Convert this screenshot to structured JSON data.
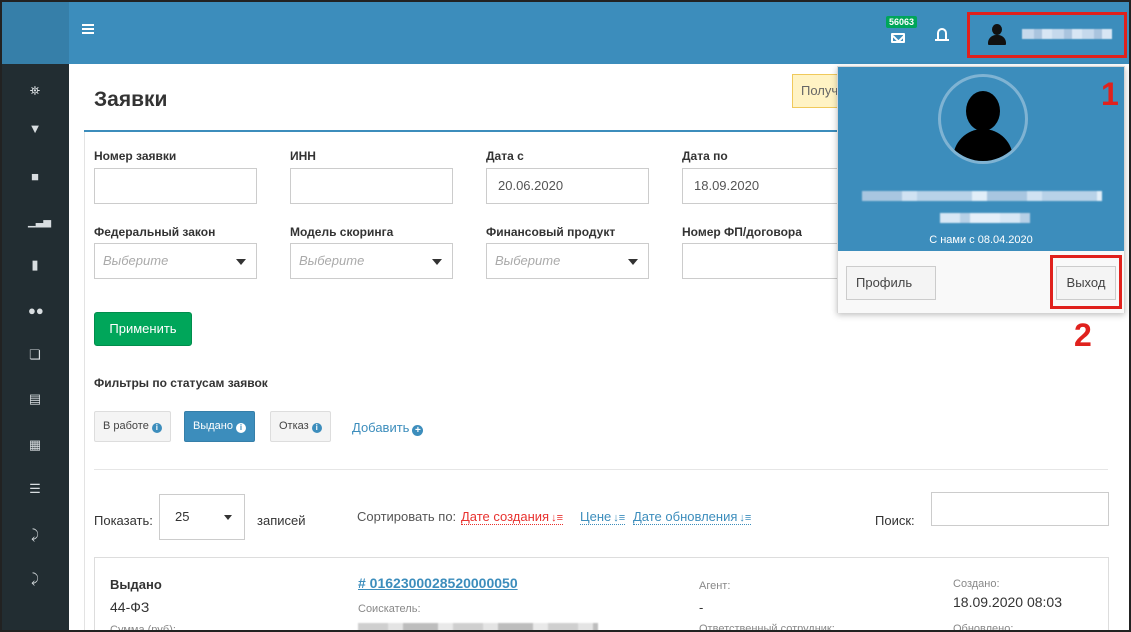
{
  "topbar": {
    "mail_count": "56063",
    "mail_icon": "envelope-icon",
    "bell_icon": "bell-icon",
    "user_icon": "user-icon",
    "menu_icon": "hamburger-icon"
  },
  "sidebar": {
    "icons": [
      "bank-icon",
      "tie-icon",
      "archive-icon",
      "bar-chart-icon",
      "tag-icon",
      "users-icon",
      "copy-icon",
      "document-icon",
      "calculator-icon",
      "list-icon",
      "paperclip-icon",
      "paperclip-icon"
    ]
  },
  "page": {
    "title": "Заявки",
    "get_button": "Получить"
  },
  "filters": {
    "number_label": "Номер заявки",
    "number_value": "",
    "inn_label": "ИНН",
    "inn_value": "",
    "date_from_label": "Дата с",
    "date_from_value": "20.06.2020",
    "date_to_label": "Дата по",
    "date_to_value": "18.09.2020",
    "law_label": "Федеральный закон",
    "law_placeholder": "Выберите",
    "model_label": "Модель скоринга",
    "model_placeholder": "Выберите",
    "product_label": "Финансовый продукт",
    "product_placeholder": "Выберите",
    "contract_label": "Номер ФП/договора",
    "contract_value": "",
    "apply_button": "Применить"
  },
  "status_filters": {
    "title": "Фильтры по статусам заявок",
    "buttons": [
      "В работе",
      "Выдано",
      "Отказ"
    ],
    "active": "Выдано",
    "add_link": "Добавить"
  },
  "table_controls": {
    "show_label": "Показать:",
    "page_size": "25",
    "records_label": "записей",
    "sort_label": "Сортировать по:",
    "sort_options": [
      "Дате создания",
      "Цене",
      "Дате обновления"
    ],
    "sort_active": "Дате создания",
    "search_label": "Поиск:",
    "search_value": ""
  },
  "card": {
    "status": "Выдано",
    "law": "44-ФЗ",
    "sum_label": "Сумма (руб):",
    "number": "# 0162300028520000050",
    "applicant_label": "Соискатель:",
    "agent_label": "Агент:",
    "agent_value": "-",
    "responsible_label": "Ответственный сотрудник:",
    "created_label": "Создано:",
    "created_value": "18.09.2020 08:03",
    "updated_label": "Обновлено:"
  },
  "user_menu": {
    "since": "С нами с 08.04.2020",
    "profile_button": "Профиль",
    "logout_button": "Выход"
  },
  "annotations": {
    "one": "1",
    "two": "2",
    "color": "#e0211d"
  },
  "colors": {
    "primary": "#3c8dbc",
    "sidebar": "#222d32",
    "success": "#00a65a",
    "sort_active": "#e8322f"
  }
}
